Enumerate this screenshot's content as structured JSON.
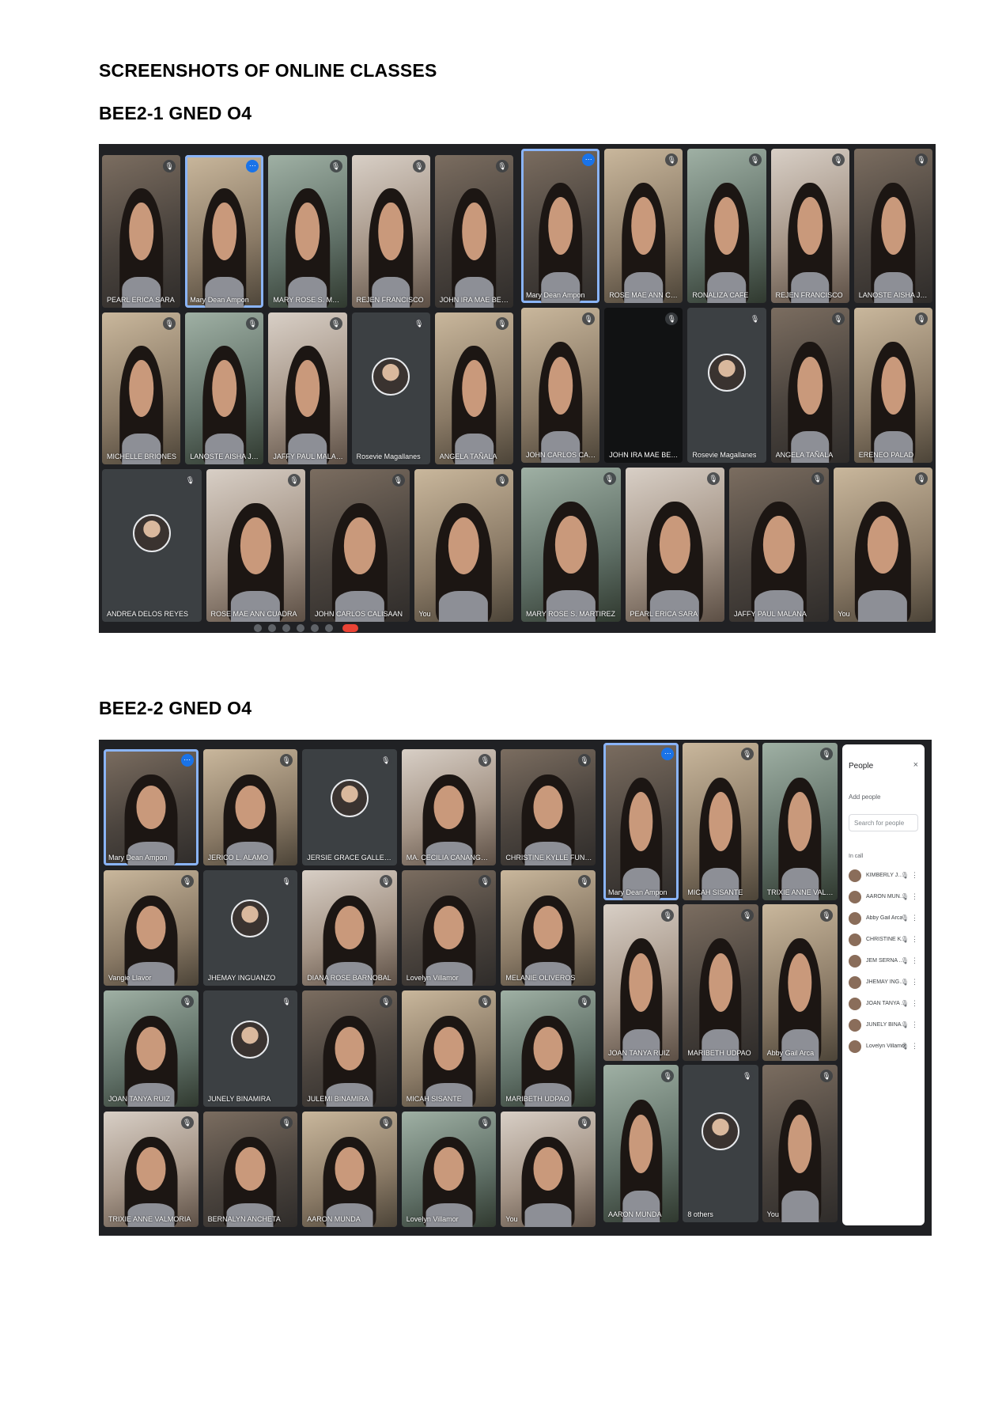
{
  "page": {
    "title": "SCREENSHOTS OF ONLINE CLASSES",
    "section1_heading": "BEE2-1 GNED O4",
    "section2_heading": "BEE2-2 GNED O4"
  },
  "section1": {
    "left": [
      "PEARL ERICA SARA",
      "Mary Dean Ampon",
      "MARY ROSE S. MARTIREZ",
      "REJEN FRANCISCO",
      "JOHN IRA MAE BERMUDEZ",
      "MICHELLE BRIONES",
      "LANOSTE AISHA JOICE",
      "JAFFY PAUL MALANA",
      "Rosevie Magallanes",
      "ANGELA TAÑALA",
      "ANDREA DELOS REYES",
      "ROSE MAE ANN CUADRA",
      "JOHN CARLOS CALISAAN",
      "You"
    ],
    "right": [
      "Mary Dean Ampon",
      "ROSE MAE ANN CUADRA",
      "RONALIZA CAFE",
      "REJEN FRANCISCO",
      "LANOSTE AISHA JOICE",
      "JOHN CARLOS CALISAAN",
      "JOHN IRA MAE BERMUDEZ",
      "Rosevie Magallanes",
      "ANGELA TAÑALA",
      "ERENEO PALAD",
      "MARY ROSE S. MARTIREZ",
      "PEARL ERICA SARA",
      "JAFFY PAUL MALANA",
      "You"
    ]
  },
  "section2": {
    "left": [
      "Mary Dean Ampon",
      "JERICO L. ALAMO",
      "JERSIE GRACE GALLEGO",
      "MA. CECILIA CANANGGA CANA...",
      "CHRISTINE KYLLE FUNTILAR",
      "Vangie Llavor",
      "JHEMAY INGUANZO",
      "DIANA ROSE BARNOBAL",
      "Lovelyn Villamor",
      "MELANIE OLIVEROS",
      "JOAN TANYA RUIZ",
      "JUNELY BINAMIRA",
      "JULEMI BINAMIRA",
      "MICAH SISANTE",
      "MARIBETH UDPAO",
      "TRIXIE ANNE VALMORIA",
      "BERNALYN ANCHETA",
      "AARON MUNDA",
      "Lovelyn Villamor",
      "You"
    ],
    "right": [
      "Mary Dean Ampon",
      "MICAH SISANTE",
      "TRIXIE ANNE VALMORIA",
      "JOAN TANYA RUIZ",
      "MARIBETH UDPAO",
      "Abby Gail Arca",
      "AARON MUNDA",
      "8 others",
      "You"
    ],
    "people_panel": {
      "title": "People",
      "close": "×",
      "add": "Add people",
      "search_placeholder": "Search for people",
      "in_call": "In call",
      "members": [
        "KIMBERLY JOHN... (You)",
        "AARON MUNDA",
        "Abby Gail Arca",
        "CHRISTINE KYLLE FUNTIL...",
        "JEM SERNA ABENOJA",
        "JHEMAY INGUANZO",
        "JOAN TANYA RUIZ",
        "JUNELY BINAMIRA",
        "Lovelyn Villamor"
      ]
    }
  }
}
